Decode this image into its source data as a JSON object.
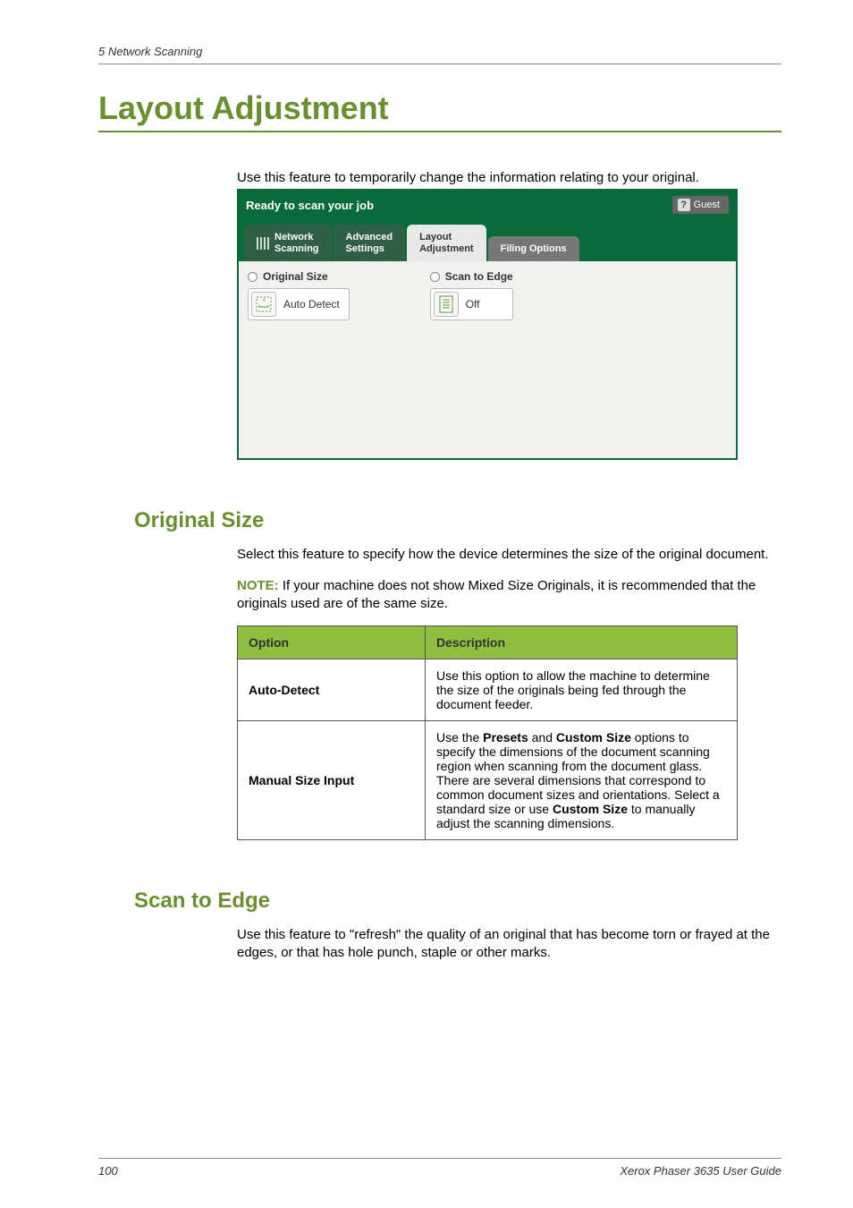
{
  "running_header": "5   Network Scanning",
  "title": "Layout Adjustment",
  "intro": "Use this feature to temporarily change the information relating to your original.",
  "screenshot": {
    "status": "Ready to scan your job",
    "guest_label": "Guest",
    "tabs": {
      "network_scanning": "Network\nScanning",
      "advanced_settings": "Advanced\nSettings",
      "layout_adjustment": "Layout\nAdjustment",
      "filing_options": "Filing Options"
    },
    "body": {
      "original_size_label": "Original Size",
      "auto_detect": "Auto Detect",
      "scan_to_edge_label": "Scan to Edge",
      "off": "Off"
    }
  },
  "original_size": {
    "heading": "Original Size",
    "para": "Select this feature to specify how the device determines the size of the original document.",
    "note_label": "NOTE:",
    "note_text": " If your machine does not show Mixed Size Originals, it is recommended that the originals used are of the same size.",
    "table": {
      "h_option": "Option",
      "h_description": "Description",
      "rows": [
        {
          "name": "Auto-Detect",
          "desc": "Use this option to allow the machine to determine the size of the originals being fed through the document feeder."
        },
        {
          "name": "Manual Size Input",
          "desc_pre": "Use the ",
          "desc_b1": "Presets",
          "desc_mid1": " and ",
          "desc_b2": "Custom Size",
          "desc_mid2": " options to specify the dimensions of the document scanning region when scanning from the document glass. There are several dimensions that correspond to common document sizes and orientations. Select a standard size or use ",
          "desc_b3": "Custom Size",
          "desc_post": " to manually adjust the scanning dimensions."
        }
      ]
    }
  },
  "scan_to_edge": {
    "heading": "Scan to Edge",
    "para": "Use this feature to \"refresh\" the quality of an original that has become torn or frayed at the edges, or that has hole punch, staple or other marks."
  },
  "footer": {
    "page_no": "100",
    "doc_title": "Xerox Phaser 3635 User Guide"
  },
  "chart_data": {
    "type": "table",
    "title": "Original Size Options",
    "columns": [
      "Option",
      "Description"
    ],
    "rows": [
      [
        "Auto-Detect",
        "Use this option to allow the machine to determine the size of the originals being fed through the document feeder."
      ],
      [
        "Manual Size Input",
        "Use the Presets and Custom Size options to specify the dimensions of the document scanning region when scanning from the document glass. There are several dimensions that correspond to common document sizes and orientations. Select a standard size or use Custom Size to manually adjust the scanning dimensions."
      ]
    ]
  }
}
